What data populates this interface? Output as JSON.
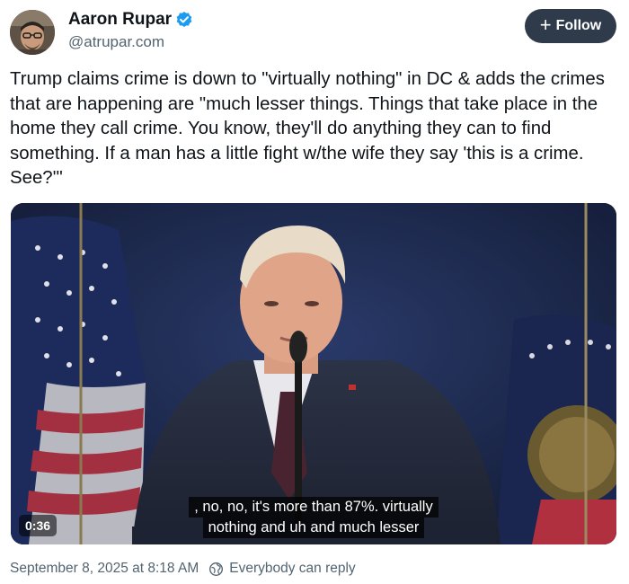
{
  "author": {
    "display_name": "Aaron Rupar",
    "handle": "@atrupar.com",
    "verified": true,
    "avatar_icon": "avatar-photo"
  },
  "follow_button": {
    "label": "Follow",
    "icon": "plus-icon",
    "bg_color": "#2f3b4a"
  },
  "post": {
    "text": "Trump claims crime is down to \"virtually nothing\" in DC & adds the crimes that are happening are \"much lesser things. Things that take place in the home they call crime. You know, they'll do anything they can to find something. If a man has a little fight w/the wife they say 'this is a crime. See?'\""
  },
  "video": {
    "duration": "0:36",
    "caption_line_1": ", no, no, it's more than 87%. virtually",
    "caption_line_2": "nothing and uh and much lesser"
  },
  "meta": {
    "timestamp": "September 8, 2025 at 8:18 AM",
    "reply_setting": "Everybody can reply",
    "reply_icon": "globe-reply-icon"
  },
  "colors": {
    "text": "#0f1419",
    "secondary": "#536471",
    "verified": "#1d9bf0"
  }
}
